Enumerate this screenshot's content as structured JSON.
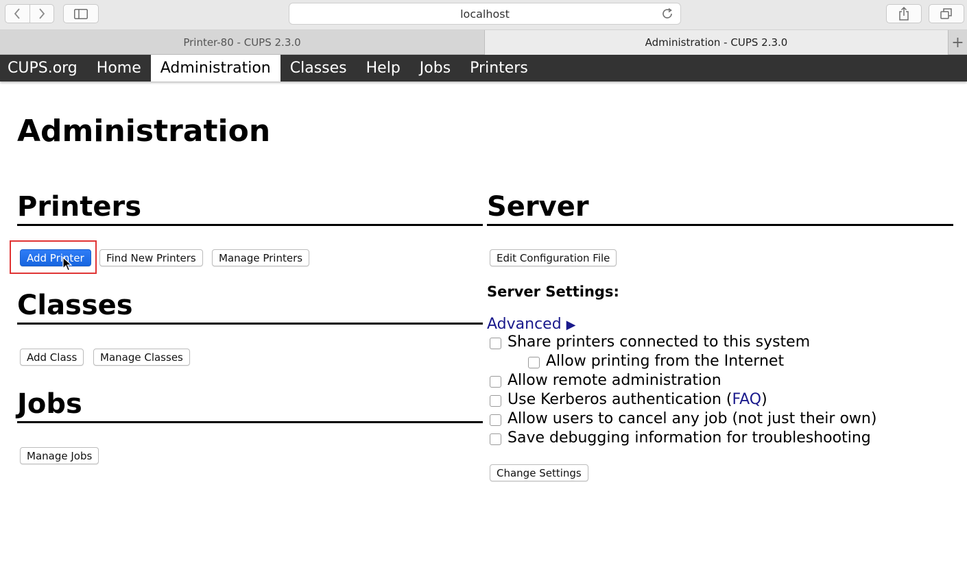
{
  "browser": {
    "url": "localhost",
    "tabs": [
      {
        "label": "Printer-80 - CUPS 2.3.0",
        "active": false
      },
      {
        "label": "Administration - CUPS 2.3.0",
        "active": true
      }
    ]
  },
  "nav": {
    "items": [
      "CUPS.org",
      "Home",
      "Administration",
      "Classes",
      "Help",
      "Jobs",
      "Printers"
    ],
    "active": "Administration"
  },
  "page": {
    "title": "Administration"
  },
  "printers": {
    "heading": "Printers",
    "add_printer": "Add Printer",
    "find_new_printers": "Find New Printers",
    "manage_printers": "Manage Printers"
  },
  "classes": {
    "heading": "Classes",
    "add_class": "Add Class",
    "manage_classes": "Manage Classes"
  },
  "jobs": {
    "heading": "Jobs",
    "manage_jobs": "Manage Jobs"
  },
  "server": {
    "heading": "Server",
    "edit_config": "Edit Configuration File",
    "settings_label": "Server Settings:",
    "advanced": "Advanced",
    "advanced_arrow": "▶",
    "options": {
      "share": "Share printers connected to this system",
      "internet": "Allow printing from the Internet",
      "remote_admin": "Allow remote administration",
      "kerberos_pre": "Use Kerberos authentication (",
      "kerberos_link": "FAQ",
      "kerberos_post": ")",
      "cancel_any": "Allow users to cancel any job (not just their own)",
      "debug": "Save debugging information for troubleshooting"
    },
    "change_settings": "Change Settings"
  },
  "colors": {
    "nav_bg": "#333333",
    "primary_button": "#1a6ae8",
    "link": "#1a1a8c",
    "highlight": "#e03434"
  }
}
